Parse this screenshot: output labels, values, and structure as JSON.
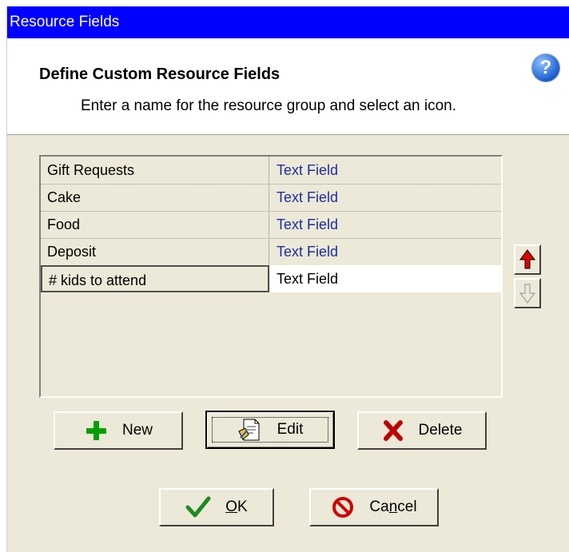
{
  "window": {
    "title": "Resource Fields"
  },
  "header": {
    "title": "Define Custom Resource Fields",
    "subtitle": "Enter a name for the resource group and select an icon."
  },
  "fields": [
    {
      "name": "Gift Requests",
      "type": "Text Field",
      "selected": false
    },
    {
      "name": "Cake",
      "type": "Text Field",
      "selected": false
    },
    {
      "name": "Food",
      "type": "Text Field",
      "selected": false
    },
    {
      "name": "Deposit",
      "type": "Text Field",
      "selected": false
    },
    {
      "name": "# kids to attend",
      "type": "Text Field",
      "selected": true
    }
  ],
  "buttons": {
    "new": "New",
    "edit": "Edit",
    "delete": "Delete",
    "ok_mnemonic": "O",
    "ok_rest": "K",
    "cancel_start": "Ca",
    "cancel_mnemonic": "n",
    "cancel_end": "cel"
  },
  "icons": {
    "help": "help-icon",
    "move_up": "arrow-up-icon",
    "move_down": "arrow-down-icon",
    "new": "plus-icon",
    "edit": "edit-document-icon",
    "delete": "x-icon",
    "ok": "checkmark-icon",
    "cancel": "no-symbol-icon"
  },
  "colors": {
    "titlebar": "#0000ff",
    "type_text": "#1c2ea0",
    "up_arrow": "#e00000",
    "plus": "#00a000",
    "delete_x": "#c00000",
    "checkmark": "#1f8a1f",
    "cancel_symbol": "#d00000"
  }
}
